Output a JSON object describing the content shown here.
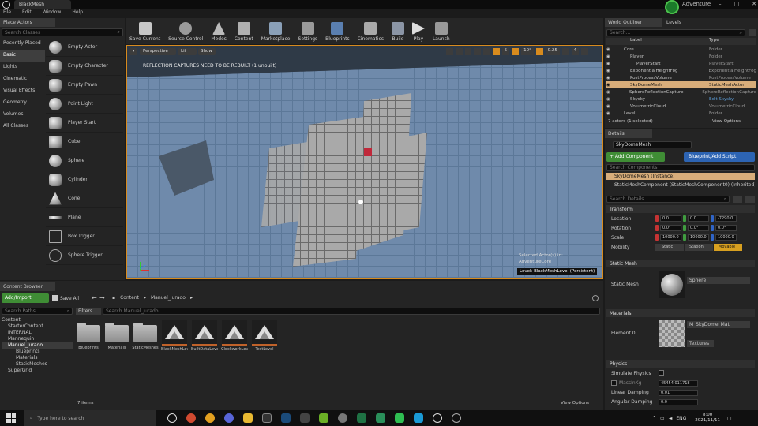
{
  "titlebar": {
    "tab": "BlackMesh",
    "project": "Adventure"
  },
  "menu": [
    "File",
    "Edit",
    "Window",
    "Help"
  ],
  "place_actors": {
    "tab": "Place Actors",
    "search_placeholder": "Search Classes",
    "categories": [
      "Recently Placed",
      "Basic",
      "Lights",
      "Cinematic",
      "Visual Effects",
      "Geometry",
      "Volumes",
      "All Classes"
    ],
    "items": [
      "Empty Actor",
      "Empty Character",
      "Empty Pawn",
      "Point Light",
      "Player Start",
      "Cube",
      "Sphere",
      "Cylinder",
      "Cone",
      "Plane",
      "Box Trigger",
      "Sphere Trigger"
    ]
  },
  "toolbar": [
    "Save Current",
    "Source Control",
    "Modes",
    "Content",
    "Marketplace",
    "Settings",
    "Blueprints",
    "Cinematics",
    "Build",
    "Play",
    "Launch"
  ],
  "viewport": {
    "perspective": "Perspective",
    "lit": "Lit",
    "show": "Show",
    "warning": "REFLECTION CAPTURES NEED TO BE REBUILT (1 unbuilt)",
    "snap": [
      "5",
      "10°",
      "0.25",
      "4"
    ],
    "selected": "Selected Actor(s) in:",
    "map": "AdventureCore",
    "level": "Level:  BlackMeshLevel (Persistent)"
  },
  "world_outliner": {
    "tab": "World Outliner",
    "tab2": "Levels",
    "search_placeholder": "Search...",
    "cols": [
      "Label",
      "Type"
    ],
    "rows": [
      {
        "label": "Core",
        "type": "Folder"
      },
      {
        "label": "Player",
        "type": "Folder"
      },
      {
        "label": "PlayerStart",
        "type": "PlayerStart"
      },
      {
        "label": "ExponentialHeightFog",
        "type": "ExponentialHeightFog"
      },
      {
        "label": "PostProcessVolume",
        "type": "PostProcessVolume"
      },
      {
        "label": "SkyDomeMesh",
        "type": "StaticMeshActor"
      },
      {
        "label": "SphereReflectionCapture",
        "type": "SphereReflectionCapture"
      },
      {
        "label": "Skysky",
        "type": "Edit Skysky"
      },
      {
        "label": "VolumetricCloud",
        "type": "VolumetricCloud"
      },
      {
        "label": "Level",
        "type": "Folder"
      }
    ],
    "footer": "7 actors (1 selected)",
    "view_options": "View Options"
  },
  "details": {
    "tab": "Details",
    "name": "SkyDomeMesh",
    "add_component": "+ Add Component",
    "blueprint": "Blueprint/Add Script",
    "search_components": "Search Components",
    "instance": "SkyDomeMesh (Instance)",
    "component": "StaticMeshComponent (StaticMeshComponent0) (Inherited)",
    "search_details": "Search Details",
    "transform": "Transform",
    "location": {
      "label": "Location",
      "x": "0.0",
      "y": "0.0",
      "z": "-7290.0"
    },
    "rotation": {
      "label": "Rotation",
      "x": "0.0°",
      "y": "0.0°",
      "z": "0.0°"
    },
    "scale": {
      "label": "Scale",
      "x": "10000.0",
      "y": "10000.0",
      "z": "10000.0"
    },
    "mobility": {
      "label": "Mobility",
      "opts": [
        "Static",
        "Station",
        "Movable"
      ]
    },
    "static_mesh_hdr": "Static Mesh",
    "static_mesh_label": "Static Mesh",
    "static_mesh_val": "Sphere",
    "materials_hdr": "Materials",
    "element": "Element 0",
    "material": "M_SkyDome_Mat",
    "textures": "Textures",
    "physics_hdr": "Physics",
    "simulate": "Simulate Physics",
    "mass": "MassInKg",
    "mass_val": "45454.011718",
    "linear": "Linear Damping",
    "linear_val": "0.01",
    "angular": "Angular Damping",
    "angular_val": "0.0"
  },
  "content_browser": {
    "tab": "Content Browser",
    "add": "Add/Import",
    "save": "Save All",
    "path": [
      "Content",
      "Manuel_Jurado"
    ],
    "search_paths": "Search Paths",
    "filters": "Filters",
    "search_placeholder": "Search Manuel_Jurado",
    "tree": [
      "Content",
      "StarterContent",
      "INTERNAL",
      "Mannequin",
      "Manuel_Jurado",
      "Blueprints",
      "Materials",
      "StaticMeshes",
      "SuperGrid"
    ],
    "assets": [
      "Blueprints",
      "Materials",
      "StaticMeshes",
      "BlackMeshLevel",
      "BuiltDataLevel",
      "ClockworkLevel",
      "TestLevel"
    ],
    "count": "7 items",
    "view_options": "View Options"
  },
  "taskbar": {
    "search": "Type here to search",
    "lang": "ENG",
    "time": "8:00",
    "date": "2021/11/11"
  }
}
